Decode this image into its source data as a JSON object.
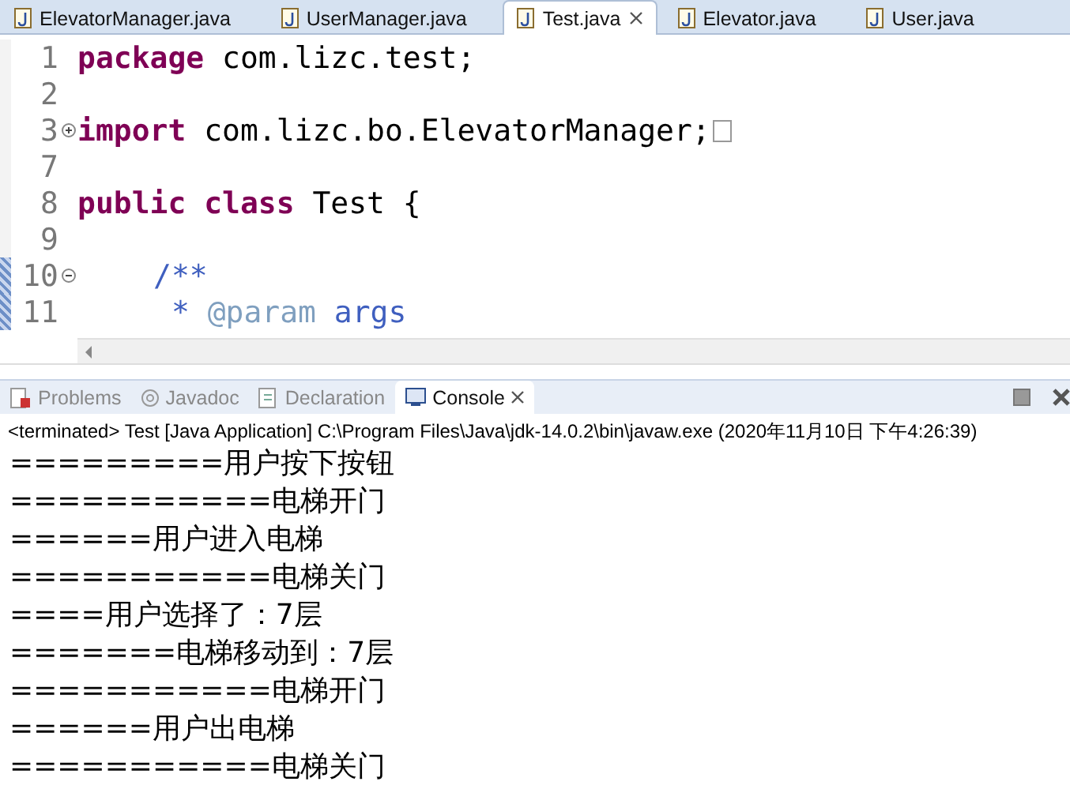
{
  "editor_tabs": [
    {
      "label": "ElevatorManager.java",
      "selected": false
    },
    {
      "label": "UserManager.java",
      "selected": false
    },
    {
      "label": "Test.java",
      "selected": true
    },
    {
      "label": "Elevator.java",
      "selected": false
    },
    {
      "label": "User.java",
      "selected": false
    }
  ],
  "editor_lines": [
    {
      "number": "1",
      "changed": false,
      "indented": false,
      "tokens": [
        {
          "kind": "keyword",
          "text": "package"
        },
        {
          "kind": "plain",
          "text": " com.lizc.test;"
        }
      ]
    },
    {
      "number": "2",
      "changed": false
    },
    {
      "number": "3",
      "changed": false,
      "indented": false,
      "collapsed": true,
      "tokens": [
        {
          "kind": "keyword",
          "text": "import"
        },
        {
          "kind": "plain",
          "text": " com.lizc.bo.ElevatorManager;"
        }
      ]
    },
    {
      "number": "7",
      "changed": false
    },
    {
      "number": "8",
      "changed": false,
      "indented": false,
      "tokens": [
        {
          "kind": "keyword",
          "text": "public"
        },
        {
          "kind": "keyword",
          "text": " class"
        },
        {
          "kind": "plain",
          "text": " Test {"
        }
      ]
    },
    {
      "number": "9",
      "changed": false
    },
    {
      "number": "10",
      "changed": true,
      "indented": true,
      "collapsed": false,
      "tokens": [
        {
          "kind": "javadoc",
          "text": "/**"
        }
      ]
    },
    {
      "number": "11",
      "changed": true,
      "indented": true,
      "tokens": [
        {
          "kind": "javadoc",
          "text": " * "
        },
        {
          "kind": "javadoc_tag",
          "text": "@param"
        },
        {
          "kind": "javadoc_name",
          "text": " args"
        }
      ]
    }
  ],
  "view_tabs": [
    {
      "label": "Problems",
      "kind": "problems",
      "selected": false
    },
    {
      "label": "Javadoc",
      "kind": "javadoc",
      "selected": false
    },
    {
      "label": "Declaration",
      "kind": "declaration",
      "selected": false
    },
    {
      "label": "Console",
      "kind": "console",
      "selected": true
    }
  ],
  "console": {
    "header": "<terminated> Test [Java Application] C:\\Program Files\\Java\\jdk-14.0.2\\bin\\javaw.exe (2020年11月10日 下午4:26:39)",
    "lines": [
      "=========用户按下按钮",
      "===========电梯开门",
      "======用户进入电梯",
      "===========电梯关门",
      "====用户选择了：7层",
      "=======电梯移动到：7层",
      "===========电梯开门",
      "======用户出电梯",
      "===========电梯关门"
    ]
  }
}
